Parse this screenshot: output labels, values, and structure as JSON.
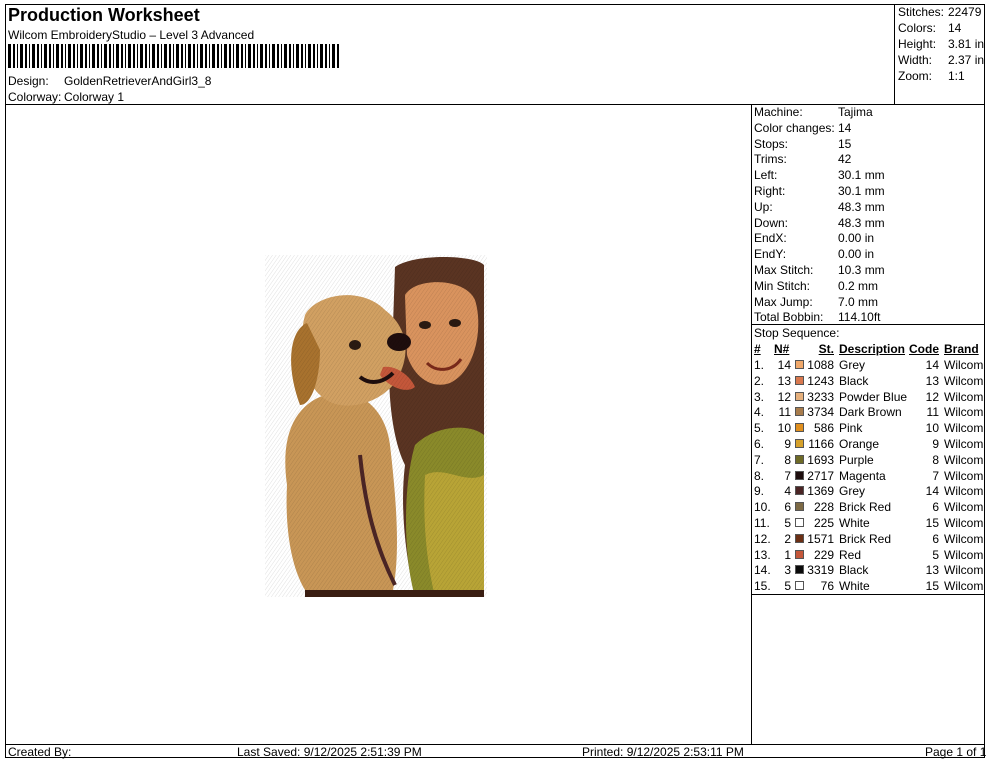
{
  "header": {
    "title": "Production Worksheet",
    "software": "Wilcom EmbroideryStudio – Level 3 Advanced",
    "design_label": "Design:",
    "design_value": "GoldenRetrieverAndGirl3_8",
    "colorway_label": "Colorway:",
    "colorway_value": "Colorway 1"
  },
  "summary": {
    "stitches_label": "Stitches:",
    "stitches_value": "22479",
    "colors_label": "Colors:",
    "colors_value": "14",
    "height_label": "Height:",
    "height_value": "3.81 in",
    "width_label": "Width:",
    "width_value": "2.37 in",
    "zoom_label": "Zoom:",
    "zoom_value": "1:1"
  },
  "machine_info": [
    {
      "label": "Machine:",
      "value": "Tajima"
    },
    {
      "label": "Color changes:",
      "value": "14"
    },
    {
      "label": "Stops:",
      "value": "15"
    },
    {
      "label": "Trims:",
      "value": "42"
    },
    {
      "label": "Left:",
      "value": "30.1 mm"
    },
    {
      "label": "Right:",
      "value": "30.1 mm"
    },
    {
      "label": "Up:",
      "value": "48.3 mm"
    },
    {
      "label": "Down:",
      "value": "48.3 mm"
    },
    {
      "label": "EndX:",
      "value": "0.00 in"
    },
    {
      "label": "EndY:",
      "value": "0.00 in"
    },
    {
      "label": "Max Stitch:",
      "value": "10.3 mm"
    },
    {
      "label": "Min Stitch:",
      "value": "0.2 mm"
    },
    {
      "label": "Max Jump:",
      "value": "7.0 mm"
    },
    {
      "label": "Total Bobbin:",
      "value": "114.10ft"
    }
  ],
  "stop_sequence": {
    "title": "Stop Sequence:",
    "headers": {
      "num": "#",
      "n": "N#",
      "st": "St.",
      "desc": "Description",
      "code": "Code",
      "brand": "Brand"
    },
    "rows": [
      {
        "num": "1.",
        "n": "14",
        "color": "#f0a86a",
        "st": "1088",
        "desc": "Grey",
        "code": "14",
        "brand": "Wilcom"
      },
      {
        "num": "2.",
        "n": "13",
        "color": "#d9784e",
        "st": "1243",
        "desc": "Black",
        "code": "13",
        "brand": "Wilcom"
      },
      {
        "num": "3.",
        "n": "12",
        "color": "#e6b07c",
        "st": "3233",
        "desc": "Powder Blue",
        "code": "12",
        "brand": "Wilcom"
      },
      {
        "num": "4.",
        "n": "11",
        "color": "#a87c4c",
        "st": "3734",
        "desc": "Dark Brown",
        "code": "11",
        "brand": "Wilcom"
      },
      {
        "num": "5.",
        "n": "10",
        "color": "#e08f1e",
        "st": "586",
        "desc": "Pink",
        "code": "10",
        "brand": "Wilcom"
      },
      {
        "num": "6.",
        "n": "9",
        "color": "#d6a12a",
        "st": "1166",
        "desc": "Orange",
        "code": "9",
        "brand": "Wilcom"
      },
      {
        "num": "7.",
        "n": "8",
        "color": "#6e6a26",
        "st": "1693",
        "desc": "Purple",
        "code": "8",
        "brand": "Wilcom"
      },
      {
        "num": "8.",
        "n": "7",
        "color": "#1e0d0d",
        "st": "2717",
        "desc": "Magenta",
        "code": "7",
        "brand": "Wilcom"
      },
      {
        "num": "9.",
        "n": "4",
        "color": "#4b2525",
        "st": "1369",
        "desc": "Grey",
        "code": "14",
        "brand": "Wilcom"
      },
      {
        "num": "10.",
        "n": "6",
        "color": "#7d6a45",
        "st": "228",
        "desc": "Brick Red",
        "code": "6",
        "brand": "Wilcom"
      },
      {
        "num": "11.",
        "n": "5",
        "color": "#ffffff",
        "st": "225",
        "desc": "White",
        "code": "15",
        "brand": "Wilcom"
      },
      {
        "num": "12.",
        "n": "2",
        "color": "#6b2f14",
        "st": "1571",
        "desc": "Brick Red",
        "code": "6",
        "brand": "Wilcom"
      },
      {
        "num": "13.",
        "n": "1",
        "color": "#c4573a",
        "st": "229",
        "desc": "Red",
        "code": "5",
        "brand": "Wilcom"
      },
      {
        "num": "14.",
        "n": "3",
        "color": "#0a0a0a",
        "st": "3319",
        "desc": "Black",
        "code": "13",
        "brand": "Wilcom"
      },
      {
        "num": "15.",
        "n": "5",
        "color": "#ffffff",
        "st": "76",
        "desc": "White",
        "code": "15",
        "brand": "Wilcom"
      }
    ]
  },
  "footer": {
    "created_by": "Created By:",
    "last_saved": "Last Saved: 9/12/2025 2:51:39 PM",
    "printed": "Printed: 9/12/2025 2:53:11 PM",
    "page": "Page 1 of 1"
  }
}
